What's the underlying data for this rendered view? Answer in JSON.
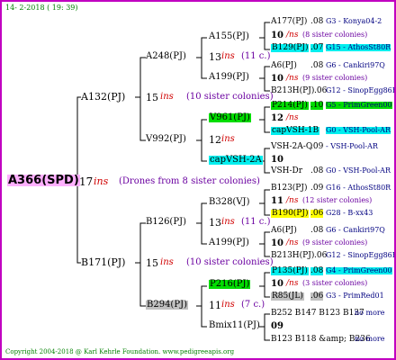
{
  "header_date": "14-  2-2018 ( 19: 39)",
  "footer": "Copyright 2004-2018 @ Karl Kehrle Foundation.   www.pedigreeapis.org",
  "colors": {
    "border": "#c000c0",
    "header": "#008000",
    "root_bg": "#ffb0ff",
    "green": "#00dd00",
    "cyan": "#00eeee",
    "yellow": "#ffff00",
    "grey": "#c0c0c0",
    "purple_text": "#6a00a0",
    "red_text": "#d00000"
  },
  "root": {
    "label": "A366(SPD)",
    "num": "17",
    "ins": "ins",
    "note": "(Drones from 8 sister colonies)"
  },
  "gen1": [
    {
      "label": "A132(PJ)",
      "num": "15",
      "ins": "ins",
      "note": "(10 sister colonies)"
    },
    {
      "label": "B171(PJ)",
      "num": "15",
      "ins": "ins",
      "note": "(10 sister colonies)"
    }
  ],
  "gen2": [
    {
      "label": "A248(PJ)",
      "num": "13",
      "ins": "ins",
      "note": "(11 c.)"
    },
    {
      "label": "V992(PJ)",
      "num": "12",
      "ins": "ins",
      "note": ""
    },
    {
      "label": "B126(PJ)",
      "num": "13",
      "ins": "ins",
      "note": "(11 c.)"
    },
    {
      "label": "B294(PJ)",
      "num": "11",
      "ins": "ins",
      "note": "(7 c.)"
    }
  ],
  "gen3": [
    "A155(PJ)",
    "A199(PJ)",
    "V961(PJ)",
    "capVSH-2A",
    "B328(VJ)",
    "A199(PJ)",
    "P216(PJ)",
    "Bmix11(PJ)"
  ],
  "gen4_rows": [
    {
      "a": "A177(PJ)",
      "b": ".08",
      "c": "G3 - Konya04-2"
    },
    {
      "a": "10",
      "b": "/ns",
      "c": "(8 sister colonies)"
    },
    {
      "a": "B129(PJ)",
      "b": ".07",
      "c": "G15 - AthosSt80R"
    },
    {
      "a": "A6(PJ)",
      "b": ".08",
      "c": "G6 - Cankiri97Q"
    },
    {
      "a": "10",
      "b": "/ns",
      "c": "(9 sister colonies)"
    },
    {
      "a": "B213H(PJ)",
      "b": ".06",
      "c": "G12 - SinopEgg86R"
    },
    {
      "a": "P214(PJ)",
      "b": ".10",
      "c": "G5 - PrimGreen00"
    },
    {
      "a": "12",
      "b": "/ns",
      "c": ""
    },
    {
      "a": "capVSH-1B",
      "b": "",
      "c": "G0 - VSH-Pool-AR"
    },
    {
      "a": "VSH-2A-Q",
      "b": ".09",
      "c": "- VSH-Pool-AR"
    },
    {
      "a": "10",
      "b": "",
      "c": ""
    },
    {
      "a": "VSH-Dr",
      "b": ".08",
      "c": "G0 - VSH-Pool-AR"
    },
    {
      "a": "B123(PJ)",
      "b": ".09",
      "c": "G16 - AthosSt80R"
    },
    {
      "a": "11",
      "b": "/ns",
      "c": "(12 sister colonies)"
    },
    {
      "a": "B190(PJ)",
      "b": ".06",
      "c": "G28 - B-xx43"
    },
    {
      "a": "A6(PJ)",
      "b": ".08",
      "c": "G6 - Cankiri97Q"
    },
    {
      "a": "10",
      "b": "/ns",
      "c": "(9 sister colonies)"
    },
    {
      "a": "B213H(PJ)",
      "b": ".06",
      "c": "G12 - SinopEgg86R"
    },
    {
      "a": "P135(PJ)",
      "b": ".08",
      "c": "G4 - PrimGreen00"
    },
    {
      "a": "10",
      "b": "/ns",
      "c": "(3 sister colonies)"
    },
    {
      "a": "R85(JL)",
      "b": ".06",
      "c": "G3 - PrimRed01"
    },
    {
      "a": "B252 B147 B123 B137",
      "b": "",
      "c": "no more"
    },
    {
      "a": "09",
      "b": "",
      "c": ""
    },
    {
      "a": "B123 B118 &amp; B236",
      "b": "",
      "c": "no more"
    }
  ]
}
